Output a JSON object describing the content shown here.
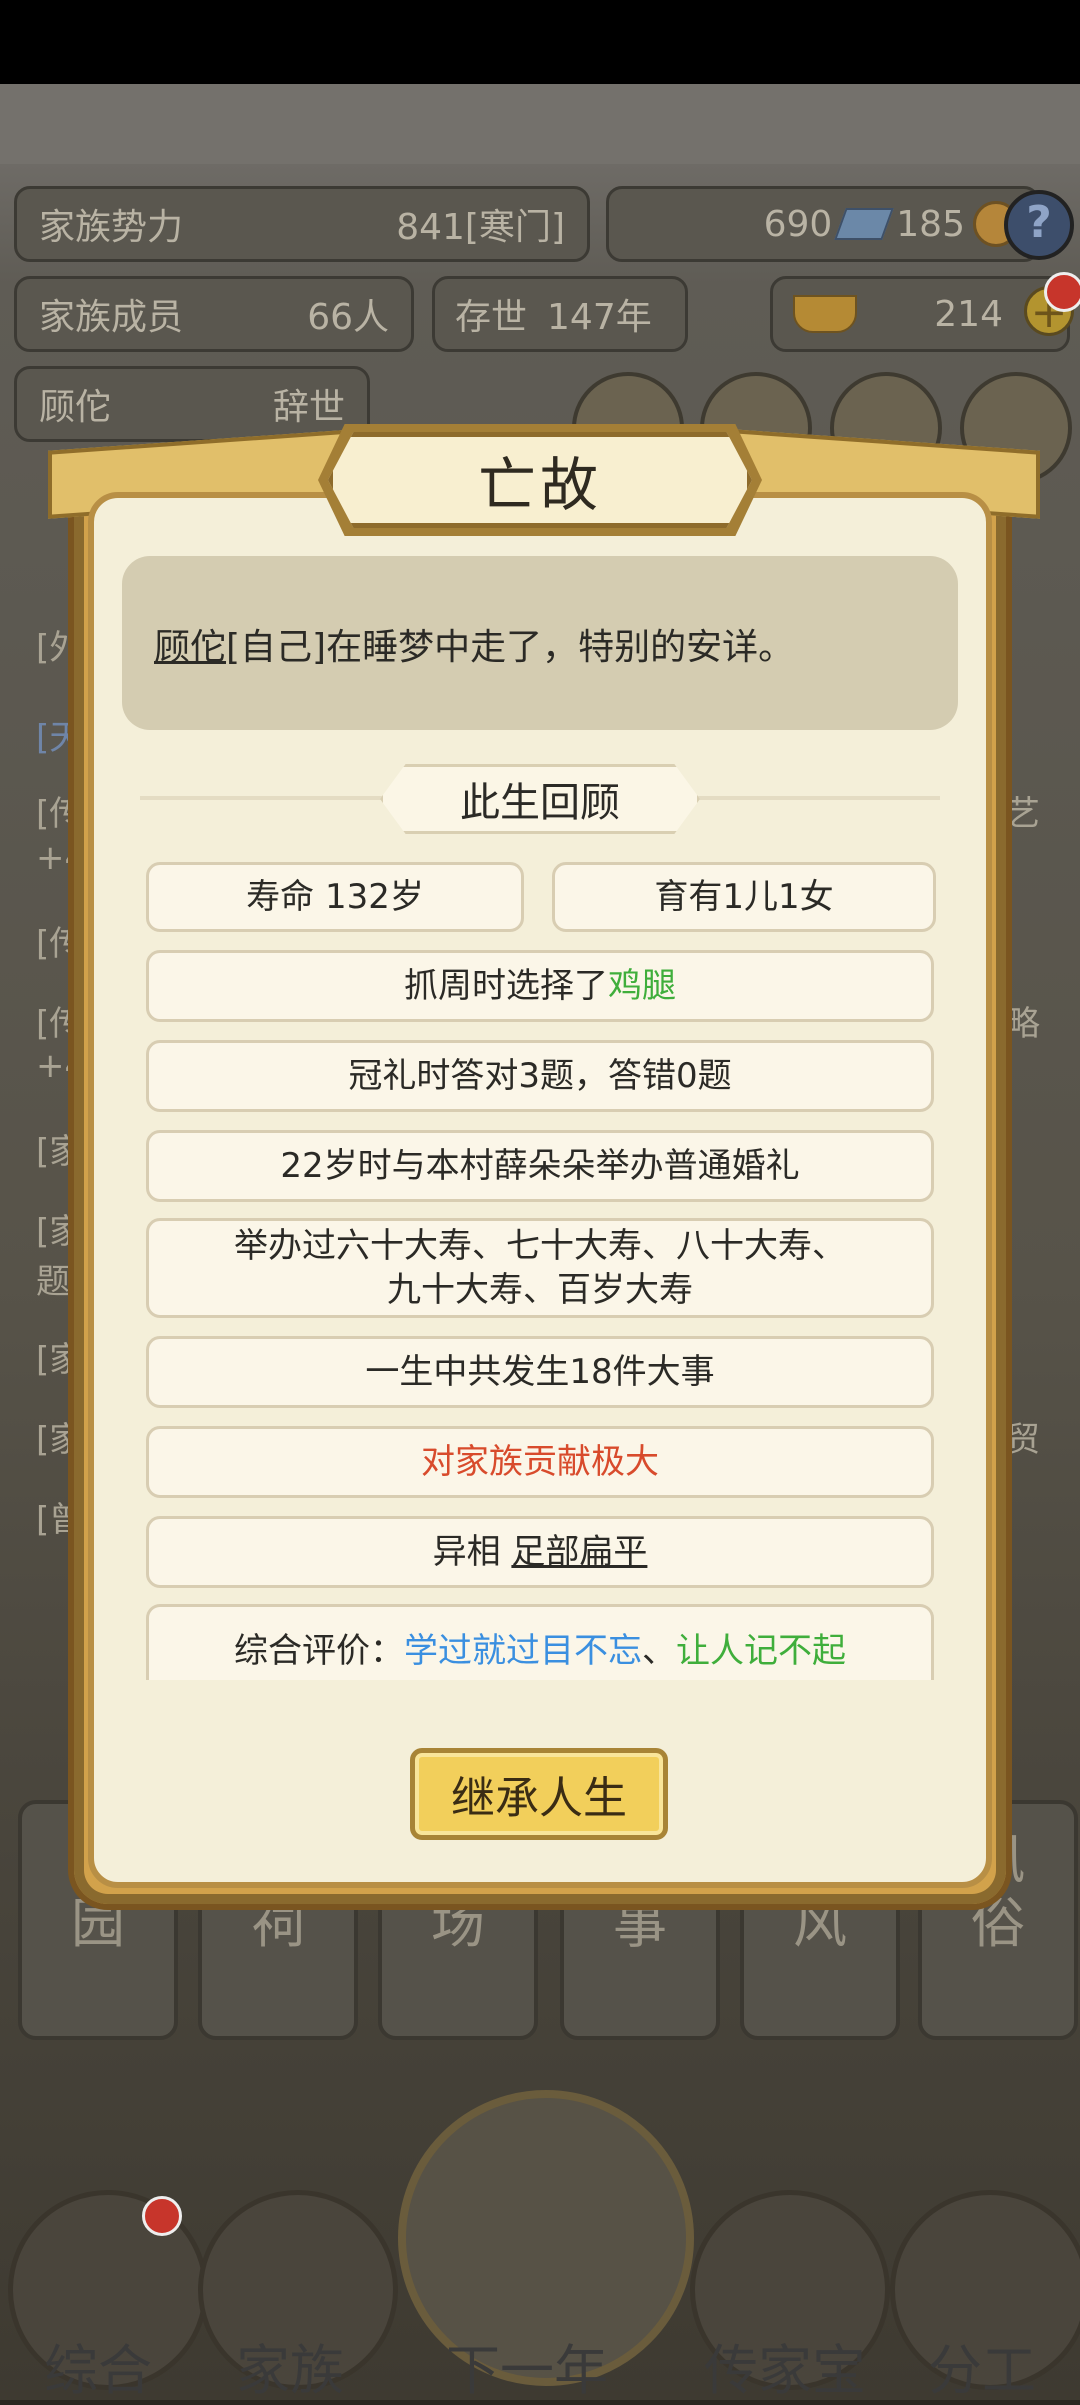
{
  "status_bar": {},
  "stats": {
    "influence_label": "家族势力",
    "influence_value": "841",
    "influence_rank": "[寒门]",
    "jade": "690",
    "coins": "185",
    "members_label": "家族成员",
    "members_value": "66人",
    "years_label": "存世",
    "years_value": "147年",
    "gold": "214",
    "person_name": "顾佗",
    "person_status": "辞世"
  },
  "background_log": {
    "left_fragments": [
      "[外",
      "[天",
      "[传",
      "+4",
      "[传",
      "[传",
      "+4",
      "[家",
      "[家",
      "题",
      "[家",
      "[家",
      "[曾"
    ],
    "right_fragments": [
      "艺",
      "略",
      "贸"
    ]
  },
  "bottom_tabs": [
    {
      "label": "药\n园"
    },
    {
      "label": "宗\n祠"
    },
    {
      "label": "市\n场"
    },
    {
      "label": "大\n事"
    },
    {
      "label": "家\n风"
    },
    {
      "label": "风\n俗"
    }
  ],
  "bottom_nav": [
    {
      "label": "综合",
      "icon": "scroll-icon"
    },
    {
      "label": "家族",
      "icon": "house-icon"
    },
    {
      "label": "下一年",
      "icon": "mountain-icon"
    },
    {
      "label": "传家宝",
      "icon": "treasure-icon"
    },
    {
      "label": "分工",
      "icon": "people-icon"
    }
  ],
  "dialog": {
    "title": "亡故",
    "message_name": "顾佗",
    "message_rest": "[自己]在睡梦中走了，特别的安详。",
    "section_title": "此生回顾",
    "lifespan": "寿命 132岁",
    "children": "育有1儿1女",
    "zhuazhou_prefix": "抓周时选择了",
    "zhuazhou_item": "鸡腿",
    "guanli": "冠礼时答对3题，答错0题",
    "wedding": "22岁时与本村薛朵朵举办普通婚礼",
    "birthdays_line1": "举办过六十大寿、七十大寿、八十大寿、",
    "birthdays_line2": "九十大寿、百岁大寿",
    "events": "一生中共发生18件大事",
    "contribution": "对家族贡献极大",
    "trait_prefix": "异相",
    "trait_value": "足部扁平",
    "eval_prefix": "综合评价：",
    "eval_a": "学过就过目不忘",
    "eval_sep": "、",
    "eval_b": "让人记不起",
    "button_label": "继承人生"
  },
  "colors": {
    "accent_gold": "#f2cf5b",
    "green_text": "#3fae3b",
    "red_text": "#d84b2c",
    "blue_text": "#3a8fe0"
  }
}
